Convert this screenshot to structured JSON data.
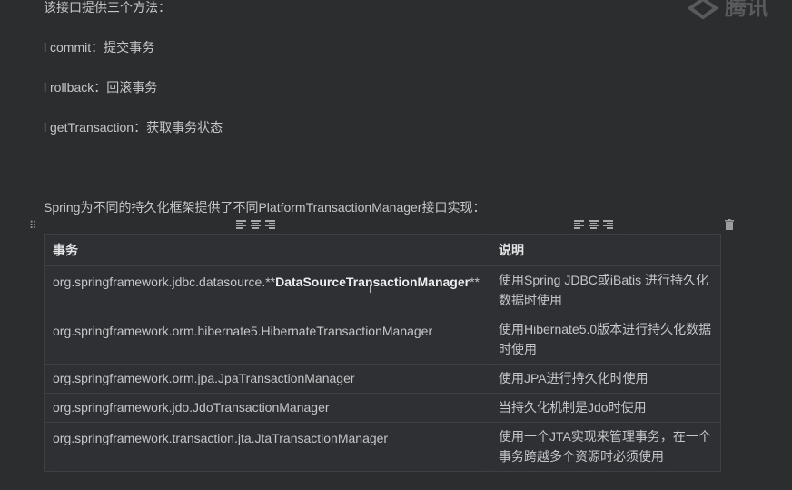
{
  "intro_line": "该接口提供三个方法：",
  "methods": [
    {
      "text": "l commit：提交事务"
    },
    {
      "text": "l rollback：回滚事务"
    },
    {
      "text": "l getTransaction：获取事务状态"
    }
  ],
  "section_heading": "Spring为不同的持久化框架提供了不同PlatformTransactionManager接口实现：",
  "watermark": "腾讯",
  "toolbar_icons": {
    "grid": "grid-icon",
    "align_left": "align-left-icon",
    "align_center": "align-center-icon",
    "align_right": "align-right-icon",
    "delete": "trash-icon"
  },
  "table": {
    "headers": [
      "事务",
      "说明"
    ],
    "rows": [
      {
        "pkg": "org.springframework.jdbc.datasource.**",
        "bold": "DataSourceTransactionManager",
        "suffix": "**",
        "desc": "使用Spring JDBC或iBatis 进行持久化数据时使用"
      },
      {
        "pkg": "org.springframework.orm.hibernate5.HibernateTransactionManager",
        "bold": "",
        "suffix": "",
        "desc": "使用Hibernate5.0版本进行持久化数据时使用"
      },
      {
        "pkg": "org.springframework.orm.jpa.JpaTransactionManager",
        "bold": "",
        "suffix": "",
        "desc": "使用JPA进行持久化时使用"
      },
      {
        "pkg": "org.springframework.jdo.JdoTransactionManager",
        "bold": "",
        "suffix": "",
        "desc": "当持久化机制是Jdo时使用"
      },
      {
        "pkg": "org.springframework.transaction.jta.JtaTransactionManager",
        "bold": "",
        "suffix": "",
        "desc": "使用一个JTA实现来管理事务，在一个事务跨越多个资源时必须使用"
      }
    ]
  }
}
